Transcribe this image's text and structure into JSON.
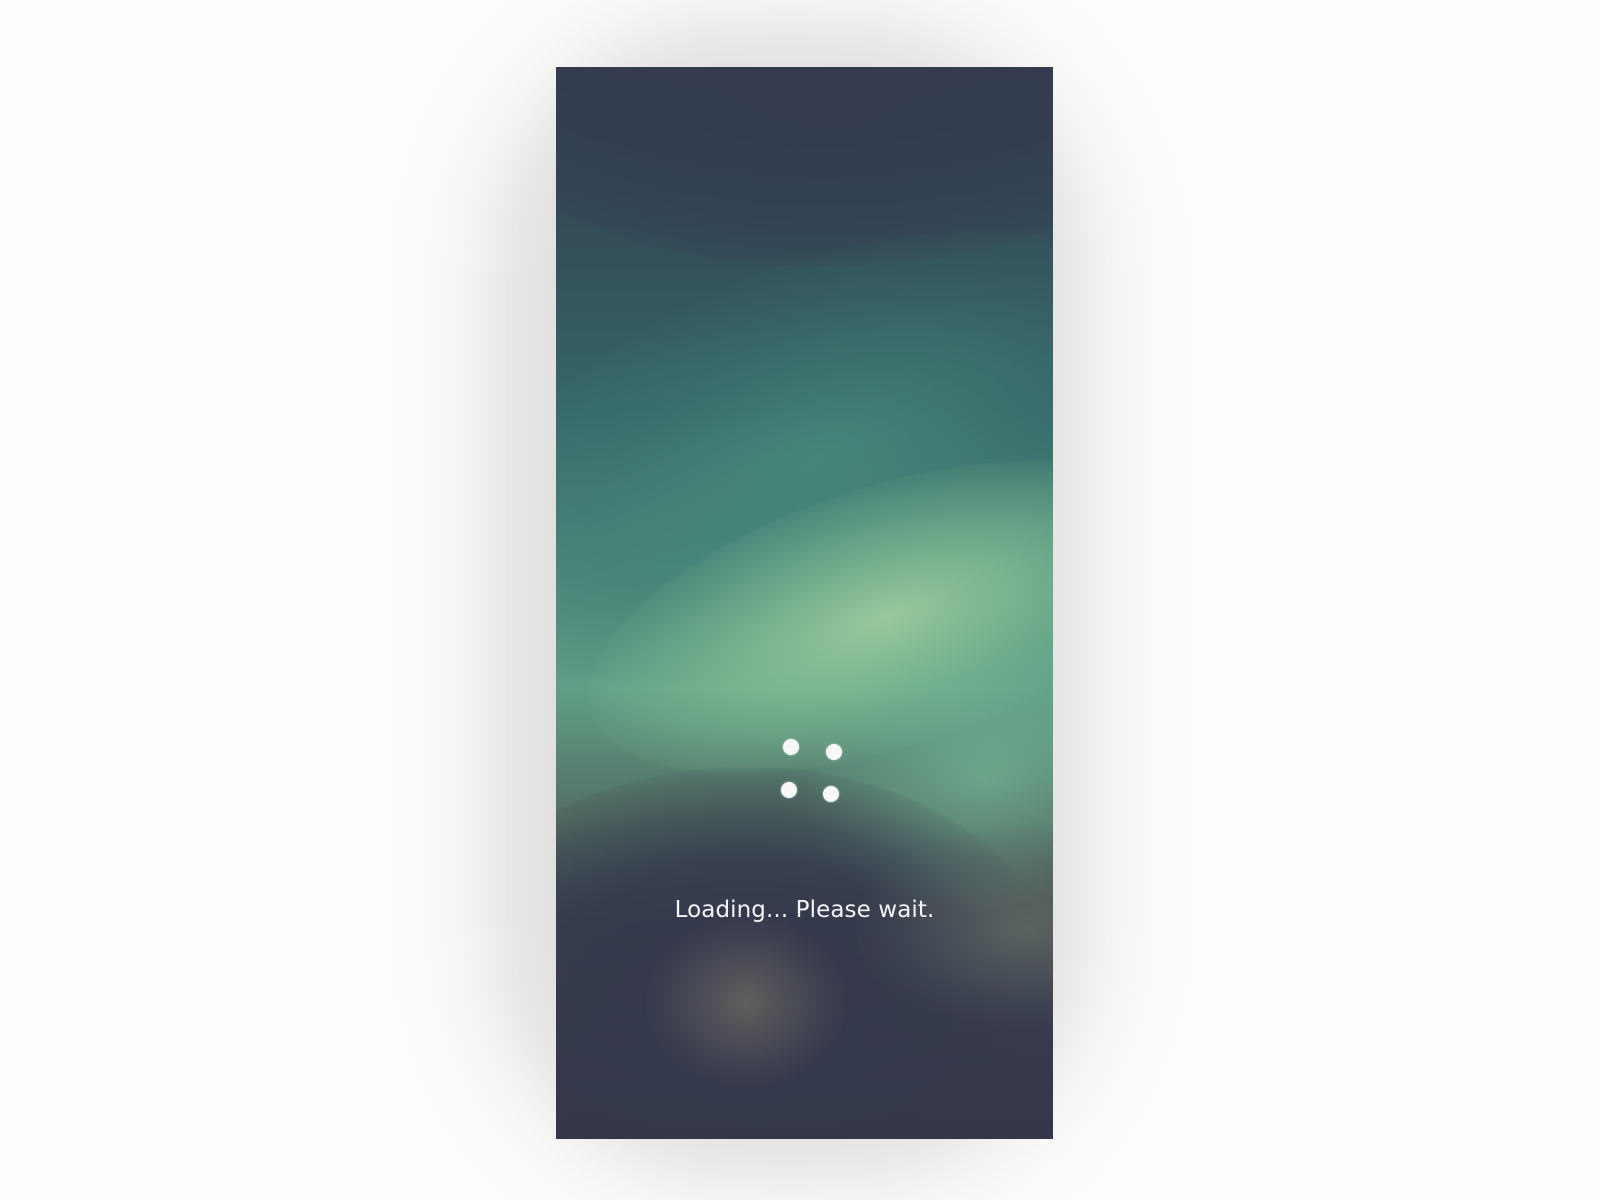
{
  "screen": {
    "loading_message": "Loading... Please wait.",
    "spinner": {
      "dot_count": 4,
      "dot_color": "#f8f8f8"
    }
  },
  "colors": {
    "page_background": "#fdfdfb",
    "gradient_dark": "#343649",
    "gradient_teal": "#36686a",
    "gradient_mint": "#5f9f86",
    "text": "#f4f4f4"
  }
}
